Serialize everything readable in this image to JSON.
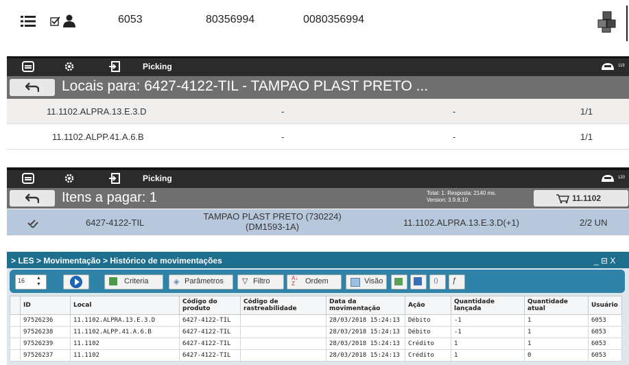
{
  "top": {
    "num1": "6053",
    "num2": "80356994",
    "num3": "0080356994"
  },
  "screen1": {
    "header_label": "Picking",
    "header_count": "119",
    "title": "Locais para: 6427-4122-TIL - TAMPAO PLAST PRETO ...",
    "rows": [
      {
        "local": "11.1102.ALPRA.13.E.3.D",
        "c2": "-",
        "c3": "-",
        "qty": "1/1"
      },
      {
        "local": "11.1102.ALPP.41.A.6.B",
        "c2": "-",
        "c3": "-",
        "qty": "1/1"
      }
    ]
  },
  "screen2": {
    "header_label": "Picking",
    "header_count": "120",
    "title": "Itens a pagar: 1",
    "status_line1": "Total: 1. Resposta: 2140 ms.",
    "status_line2": "Version: 3.9.8.10",
    "cart_label": "11.1102",
    "item": {
      "code": "6427-4122-TIL",
      "desc1": "TAMPAO PLAST PRETO (730224)",
      "desc2": "(DM1593-1A)",
      "local": "11.1102.ALPRA.13.E.3.D(+1)",
      "qty": "2/2 UN"
    }
  },
  "les": {
    "breadcrumb": "> LES > Movimentação > Histórico de movimentações",
    "window_controls": "_ ⊟ X",
    "page_size": "16",
    "buttons": {
      "criteria": "Criteria",
      "parametros": "Parâmetros",
      "filtro": "Filtro",
      "ordem": "Ordem",
      "visao": "Visão"
    },
    "columns": [
      "ID",
      "Local",
      "Código do produto",
      "Código de rastreabilidade",
      "Data da movimentação",
      "Ação",
      "Quantidade lançada",
      "Quantidade atual",
      "Usuário"
    ],
    "rows": [
      [
        "97526236",
        "11.1102.ALPRA.13.E.3.D",
        "6427-4122-TIL",
        "",
        "28/03/2018 15:24:13",
        "Débito",
        "-1",
        "1",
        "6053"
      ],
      [
        "97526238",
        "11.1102.ALPP.41.A.6.B",
        "6427-4122-TIL",
        "",
        "28/03/2018 15:24:13",
        "Débito",
        "-1",
        "1",
        "6053"
      ],
      [
        "97526239",
        "11.1102",
        "6427-4122-TIL",
        "",
        "28/03/2018 15:24:13",
        "Crédito",
        "1",
        "1",
        "6053"
      ],
      [
        "97526237",
        "11.1102",
        "6427-4122-TIL",
        "",
        "28/03/2018 15:24:13",
        "Crédito",
        "1",
        "0",
        "6053"
      ]
    ]
  }
}
